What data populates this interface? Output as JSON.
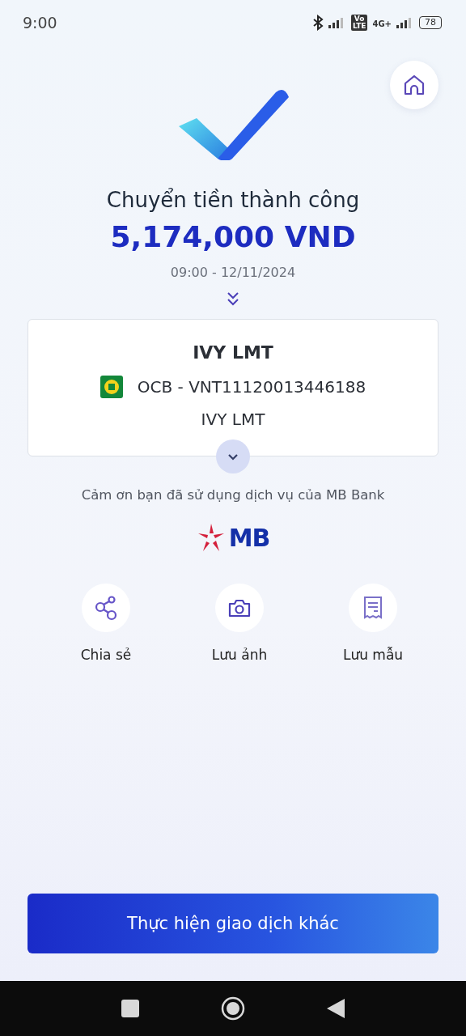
{
  "status_bar": {
    "time": "9:00",
    "volte": [
      "Vo",
      "LTE"
    ],
    "network": "4G+",
    "battery": "78"
  },
  "title": "Chuyển tiền thành công",
  "amount": "5,174,000 VND",
  "datetime": "09:00 - 12/11/2024",
  "recipient": {
    "name": "IVY LMT",
    "account": "OCB - VNT11120013446188",
    "account_name": "IVY LMT"
  },
  "thanks": "Cảm ơn bạn đã sử dụng dịch vụ của MB Bank",
  "logo": "MB",
  "actions": [
    {
      "kind": "share",
      "label": "Chia sẻ"
    },
    {
      "kind": "camera",
      "label": "Lưu ảnh"
    },
    {
      "kind": "template",
      "label": "Lưu mẫu"
    }
  ],
  "primary_button": "Thực hiện giao dịch khác"
}
